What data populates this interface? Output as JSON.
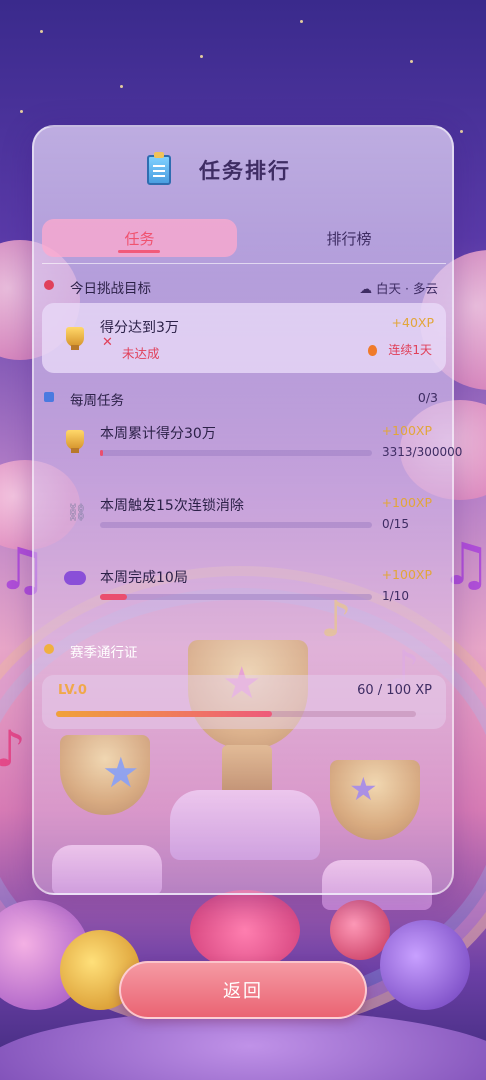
{
  "panel": {
    "title": "任务排行",
    "tabs": [
      {
        "label": "任务",
        "active": true
      },
      {
        "label": "排行榜",
        "active": false
      }
    ]
  },
  "daily": {
    "heading": "今日挑战目标",
    "weather_time": "白天",
    "weather_sep": "·",
    "weather": "多云",
    "task": {
      "title": "得分达到3万",
      "status": "未达成",
      "xp": "+40XP",
      "streak": "连续1天"
    }
  },
  "weekly": {
    "heading": "每周任务",
    "count": "0/3",
    "tasks": [
      {
        "title": "本周累计得分30万",
        "xp": "+100XP",
        "progress_text": "3313/300000",
        "progress": 0.011
      },
      {
        "title": "本周触发15次连锁消除",
        "xp": "+100XP",
        "progress_text": "0/15",
        "progress": 0.0
      },
      {
        "title": "本周完成10局",
        "xp": "+100XP",
        "progress_text": "1/10",
        "progress": 0.1
      }
    ]
  },
  "season_pass": {
    "heading": "赛季通行证",
    "level": "LV.0",
    "xp_text": "60 / 100 XP",
    "progress": 0.6
  },
  "footer": {
    "back_label": "返回"
  },
  "colors": {
    "accent": "#ea4f6e",
    "xp": "#e2a63a",
    "button": "#ea6473"
  }
}
